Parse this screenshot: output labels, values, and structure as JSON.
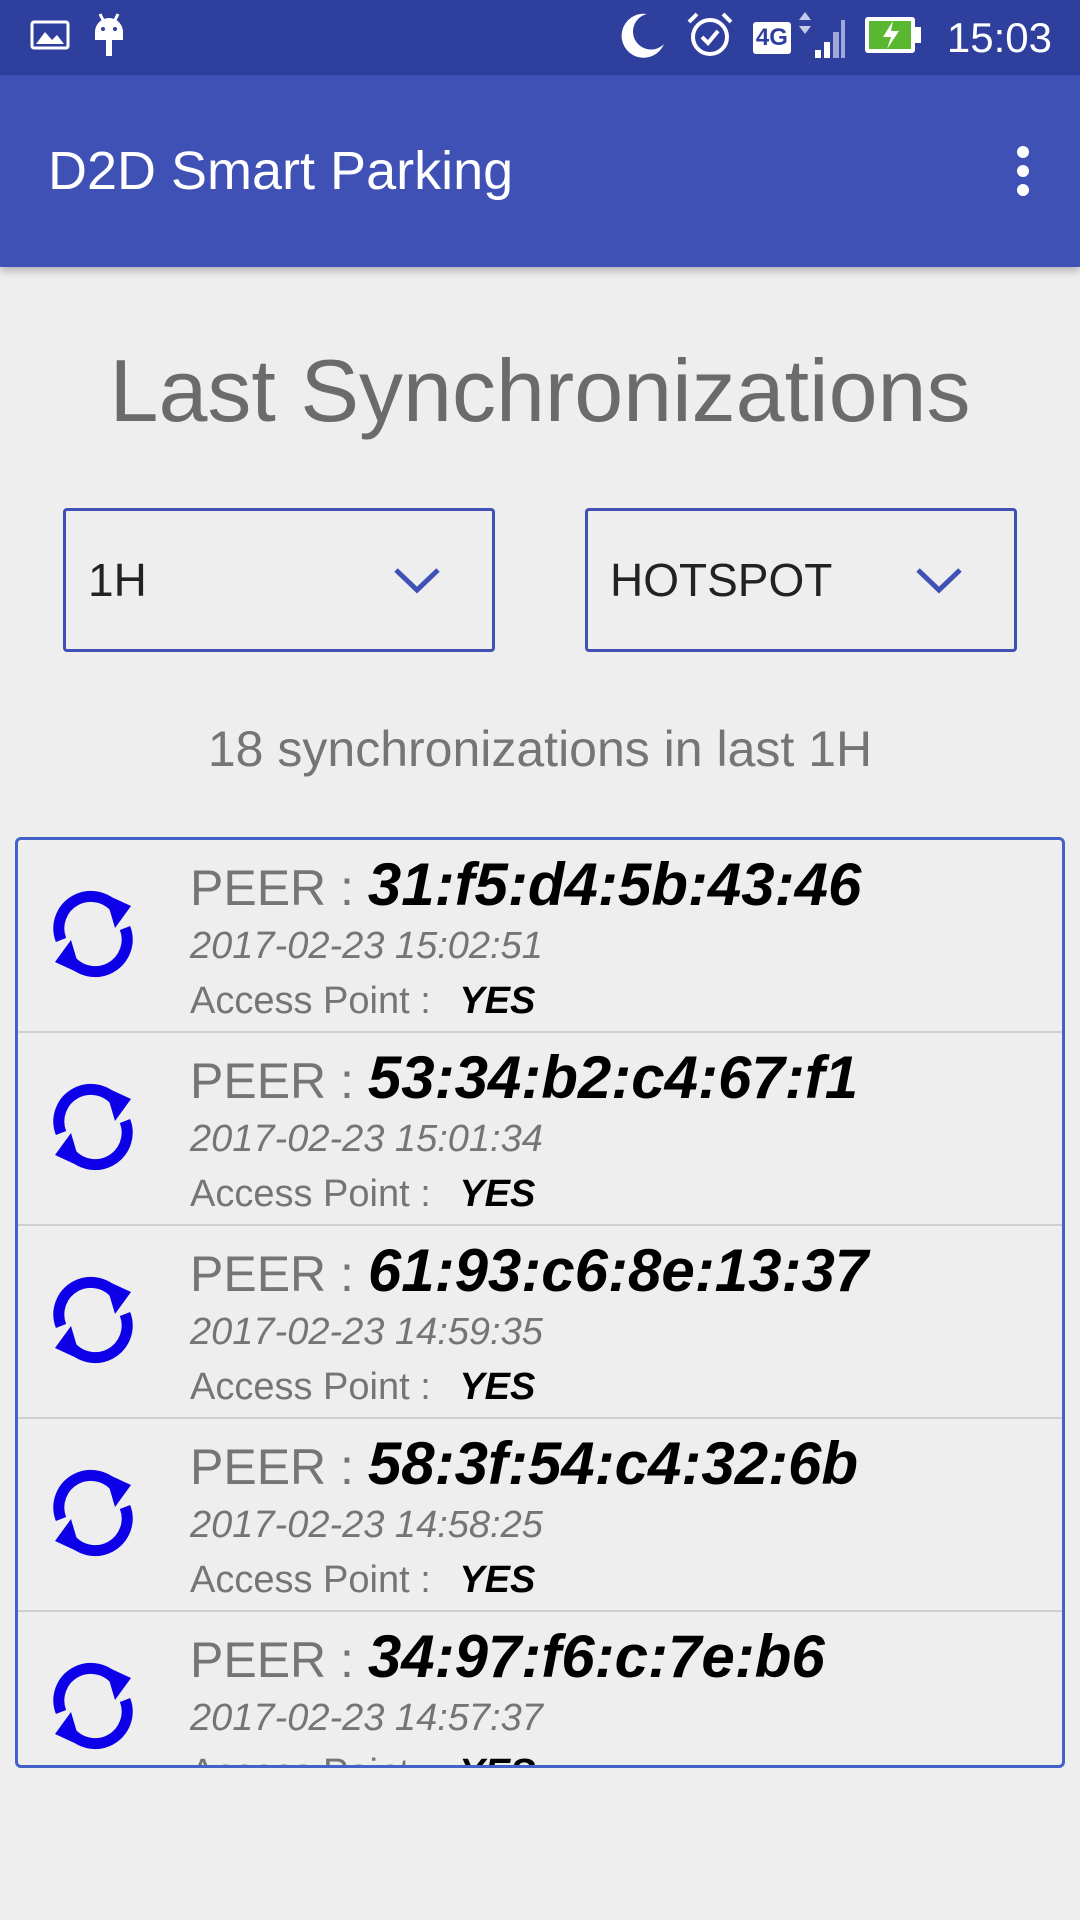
{
  "status_bar": {
    "time": "15:03",
    "network": "4G",
    "icons": [
      "image-icon",
      "android-icon",
      "moon-icon",
      "alarm-icon",
      "network-4g-icon",
      "signal-icon",
      "battery-charging-icon"
    ]
  },
  "app_bar": {
    "title": "D2D Smart Parking",
    "overflow_icon": "more-vert-icon"
  },
  "main": {
    "heading": "Last Synchronizations",
    "period_spinner": {
      "selected": "1H"
    },
    "mode_spinner": {
      "selected": "HOTSPOT"
    },
    "sync_count_text": "18 synchronizations in last 1H",
    "peer_label": "PEER : ",
    "ap_label": "Access Point : ",
    "items": [
      {
        "mac": "31:f5:d4:5b:43:46",
        "timestamp": "2017-02-23 15:02:51",
        "access_point": "YES"
      },
      {
        "mac": "53:34:b2:c4:67:f1",
        "timestamp": "2017-02-23 15:01:34",
        "access_point": "YES"
      },
      {
        "mac": "61:93:c6:8e:13:37",
        "timestamp": "2017-02-23 14:59:35",
        "access_point": "YES"
      },
      {
        "mac": "58:3f:54:c4:32:6b",
        "timestamp": "2017-02-23 14:58:25",
        "access_point": "YES"
      },
      {
        "mac": "34:97:f6:c:7e:b6",
        "timestamp": "2017-02-23 14:57:37",
        "access_point": "YES"
      }
    ]
  },
  "colors": {
    "status_bar": "#2f3f9e",
    "app_bar": "#3f51b5",
    "accent": "#3f51b5",
    "sync_icon": "#0d00e8",
    "background": "#eeeeee"
  }
}
